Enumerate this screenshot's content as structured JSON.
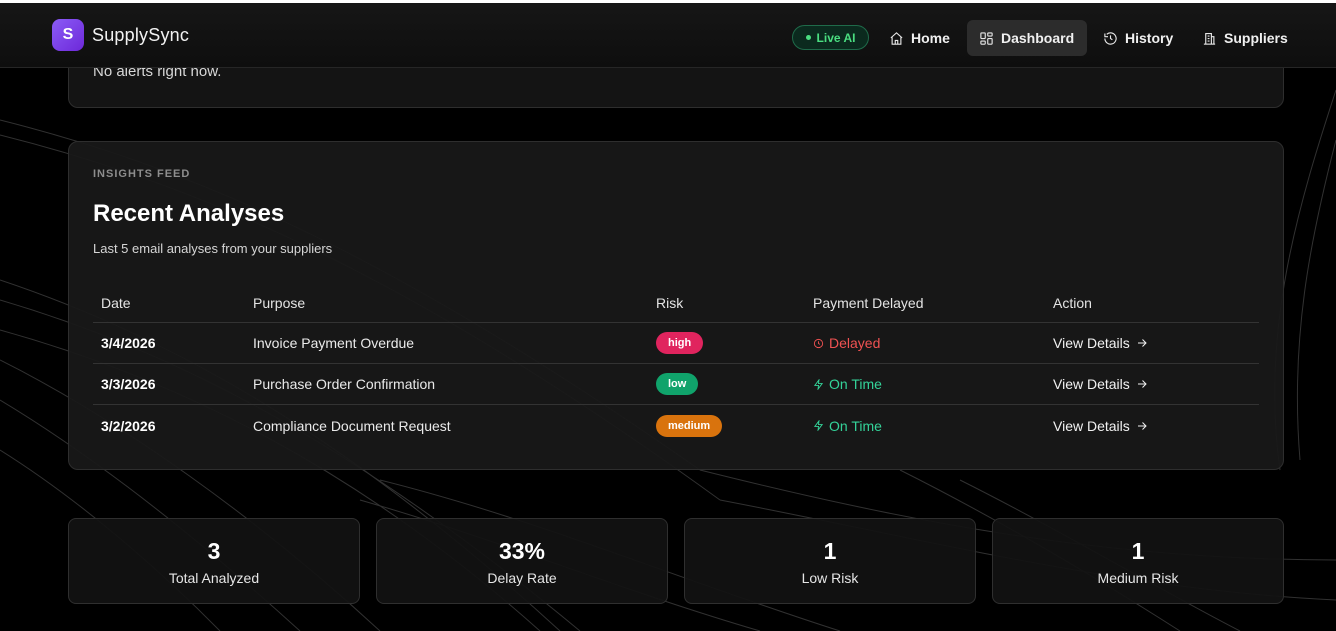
{
  "app": {
    "logo_letter": "S",
    "brand": "SupplySync",
    "live_label": "Live AI",
    "nav": [
      {
        "label": "Home",
        "icon": "home-icon",
        "active": false
      },
      {
        "label": "Dashboard",
        "icon": "dashboard-icon",
        "active": true
      },
      {
        "label": "History",
        "icon": "history-icon",
        "active": false
      },
      {
        "label": "Suppliers",
        "icon": "building-icon",
        "active": false
      }
    ]
  },
  "alerts": {
    "empty_text": "No alerts right now."
  },
  "insights": {
    "eyebrow": "INSIGHTS FEED",
    "title": "Recent Analyses",
    "subtitle": "Last 5 email analyses from your suppliers",
    "columns": [
      "Date",
      "Purpose",
      "Risk",
      "Payment Delayed",
      "Action"
    ],
    "rows": [
      {
        "date": "3/4/2026",
        "purpose": "Invoice Payment Overdue",
        "risk": "high",
        "payment": "Delayed",
        "payment_icon": "clock-icon",
        "action": "View Details"
      },
      {
        "date": "3/3/2026",
        "purpose": "Purchase Order Confirmation",
        "risk": "low",
        "payment": "On Time",
        "payment_icon": "bolt-icon",
        "action": "View Details"
      },
      {
        "date": "3/2/2026",
        "purpose": "Compliance Document Request",
        "risk": "medium",
        "payment": "On Time",
        "payment_icon": "bolt-icon",
        "action": "View Details"
      }
    ]
  },
  "stats": [
    {
      "value": "3",
      "label": "Total Analyzed"
    },
    {
      "value": "33%",
      "label": "Delay Rate"
    },
    {
      "value": "1",
      "label": "Low Risk"
    },
    {
      "value": "1",
      "label": "Medium Risk"
    }
  ],
  "colors": {
    "accent": "#7c3aed",
    "live_green": "#4ade80",
    "risk_high": "#e0245e",
    "risk_low": "#10a36b",
    "risk_medium": "#d9730d",
    "delayed": "#f05252",
    "on_time": "#34d399"
  }
}
